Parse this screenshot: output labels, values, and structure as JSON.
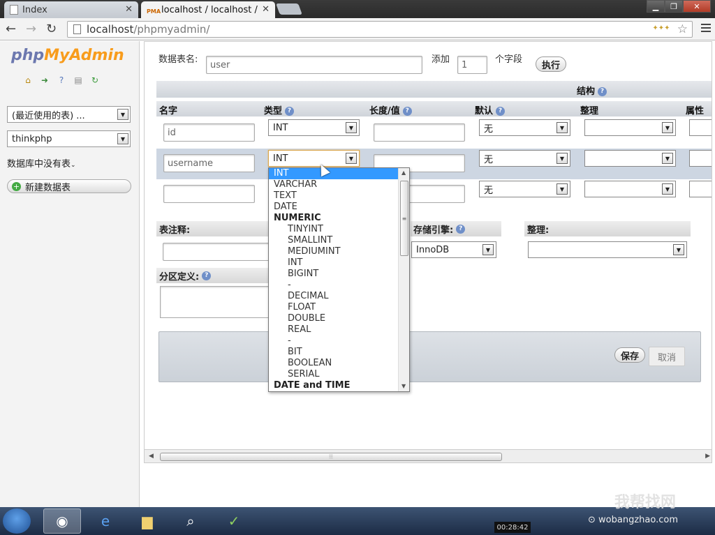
{
  "browser": {
    "tabs": [
      {
        "label": "Index"
      },
      {
        "label": "localhost / localhost / tl"
      }
    ],
    "pma_icon_text": "PMA",
    "url_host": "localhost",
    "url_path": "/phpmyadmin/"
  },
  "sidebar": {
    "logo_php": "php",
    "logo_myadmin": "MyAdmin",
    "recent_tables": "(最近使用的表) ...",
    "database": "thinkphp",
    "no_tables": "数据库中没有表",
    "new_table": "新建数据表"
  },
  "form": {
    "table_name_label": "数据表名:",
    "table_name_value": "user",
    "add_label": "添加",
    "add_count": "1",
    "fields_label": "个字段",
    "go_button": "执行",
    "structure_label": "结构",
    "columns": {
      "name": "名字",
      "type": "类型",
      "length": "长度/值",
      "default": "默认",
      "collation": "整理",
      "attributes": "属性"
    },
    "rows": [
      {
        "name": "id",
        "type": "INT",
        "default": "无"
      },
      {
        "name": "username",
        "type": "INT",
        "default": "无"
      },
      {
        "name": "",
        "type": "",
        "default": "无"
      }
    ],
    "table_comment_label": "表注释:",
    "storage_engine_label": "存储引擎:",
    "storage_engine_value": "InnoDB",
    "table_collation_label": "整理:",
    "partition_label": "分区定义:",
    "save_button": "保存",
    "cancel_button": "取消"
  },
  "type_dropdown": {
    "options": [
      {
        "label": "INT",
        "kind": "selected"
      },
      {
        "label": "VARCHAR",
        "kind": "plain"
      },
      {
        "label": "TEXT",
        "kind": "plain"
      },
      {
        "label": "DATE",
        "kind": "plain"
      },
      {
        "label": "NUMERIC",
        "kind": "group"
      },
      {
        "label": "TINYINT",
        "kind": "sub"
      },
      {
        "label": "SMALLINT",
        "kind": "sub"
      },
      {
        "label": "MEDIUMINT",
        "kind": "sub"
      },
      {
        "label": "INT",
        "kind": "sub"
      },
      {
        "label": "BIGINT",
        "kind": "sub"
      },
      {
        "label": "-",
        "kind": "sub"
      },
      {
        "label": "DECIMAL",
        "kind": "sub"
      },
      {
        "label": "FLOAT",
        "kind": "sub"
      },
      {
        "label": "DOUBLE",
        "kind": "sub"
      },
      {
        "label": "REAL",
        "kind": "sub"
      },
      {
        "label": "-",
        "kind": "sub"
      },
      {
        "label": "BIT",
        "kind": "sub"
      },
      {
        "label": "BOOLEAN",
        "kind": "sub"
      },
      {
        "label": "SERIAL",
        "kind": "sub"
      },
      {
        "label": "DATE and TIME",
        "kind": "group"
      }
    ]
  },
  "overlay": {
    "clock": "00:28:42",
    "watermark_brand": "我帮找网",
    "watermark_url": "wobangzhao.com"
  },
  "colors": {
    "selected_option": "#3399ff",
    "header_bar": "#d5dae0",
    "highlight_row": "#cdd6e2",
    "accent_blue": "#6f8fc8"
  }
}
